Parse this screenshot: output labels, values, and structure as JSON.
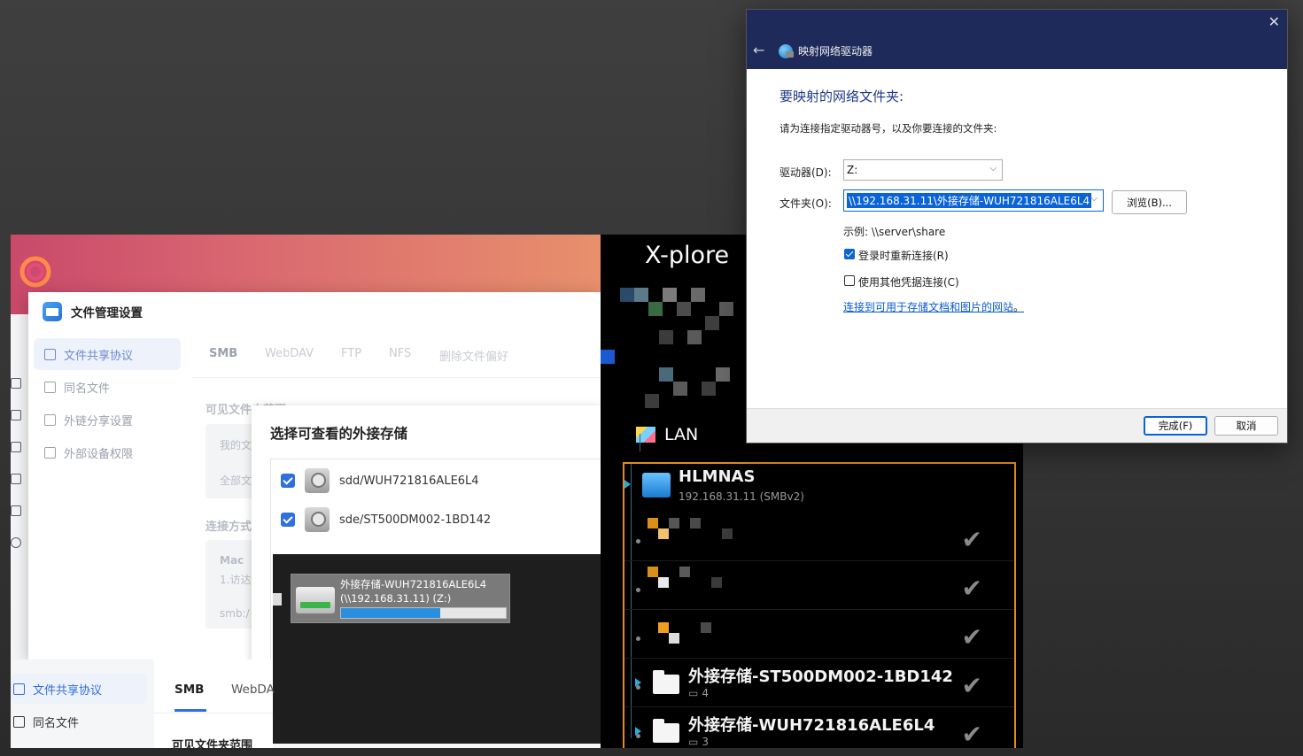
{
  "xplore": {
    "title": "X-plore",
    "lan": "LAN",
    "server_name": "HLMNAS",
    "server_addr": "192.168.31.11 (SMBv2)",
    "folders": [
      {
        "name": "外接存储-ST500DM002-1BD142",
        "count": "4"
      },
      {
        "name": "外接存储-WUH721816ALE6L4",
        "count": "3"
      }
    ]
  },
  "file_manager": {
    "dialog_title": "文件管理设置",
    "sidebar": [
      "文件共享协议",
      "同名文件",
      "外链分享设置",
      "外部设备权限"
    ],
    "tabs": [
      "SMB",
      "WebDAV",
      "FTP",
      "NFS",
      "删除文件偏好"
    ],
    "visible_scope_label": "可见文件夹范围",
    "my_files": "我的文",
    "all_files": "全部文",
    "connect_method": "连接方式",
    "mac": "Mac",
    "step1": "1.访达",
    "smb_prefix": "smb:/"
  },
  "select_storage": {
    "title": "选择可查看的外接存储",
    "items": [
      "sdd/WUH721816ALE6L4",
      "sde/ST500DM002-1BD142"
    ]
  },
  "drag_item": {
    "line1": "外接存储-WUH721816ALE6L4",
    "line2": "(\\\\192.168.31.11) (Z:)",
    "progress": 0.6
  },
  "fm_bottom": {
    "sidebar": [
      "文件共享协议",
      "同名文件"
    ],
    "tabs": [
      "SMB",
      "WebDA"
    ],
    "scope": "可见文件夹范围"
  },
  "win_dialog": {
    "title": "映射网络驱动器",
    "heading": "要映射的网络文件夹:",
    "desc": "请为连接指定驱动器号，以及你要连接的文件夹:",
    "drive_label": "驱动器(D):",
    "drive_value": "Z:",
    "folder_label": "文件夹(O):",
    "folder_value": "\\\\192.168.31.11\\外接存储-WUH721816ALE6L4",
    "browse": "浏览(B)...",
    "example": "示例: \\\\server\\share",
    "reconnect": "登录时重新连接(R)",
    "reconnect_checked": true,
    "other_cred": "使用其他凭据连接(C)",
    "other_cred_checked": false,
    "link": "连接到可用于存储文档和图片的网站",
    "link_suffix": "。",
    "finish": "完成(F)",
    "cancel": "取消",
    "accent": "#0a64d8",
    "header_color": "#1d2a5a"
  }
}
